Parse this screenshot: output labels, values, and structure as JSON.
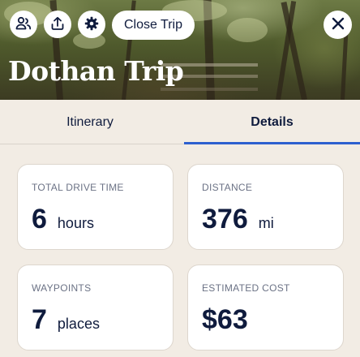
{
  "header": {
    "close_trip_label": "Close Trip",
    "trip_title": "Dothan Trip",
    "icons": [
      "group-users-icon",
      "share-upload-icon",
      "gear-icon",
      "close-icon"
    ]
  },
  "tabs": [
    {
      "label": "Itinerary",
      "active": false
    },
    {
      "label": "Details",
      "active": true
    }
  ],
  "stats": {
    "drive_time": {
      "label": "TOTAL DRIVE TIME",
      "value": "6",
      "unit": "hours"
    },
    "distance": {
      "label": "DISTANCE",
      "value": "376",
      "unit": "mi"
    },
    "waypoints": {
      "label": "WAYPOINTS",
      "value": "7",
      "unit": "places"
    },
    "cost": {
      "label": "ESTIMATED COST",
      "value": "$63"
    }
  },
  "colors": {
    "accent": "#2d60cf",
    "text": "#0f1b3d",
    "background": "#f2ece4"
  }
}
